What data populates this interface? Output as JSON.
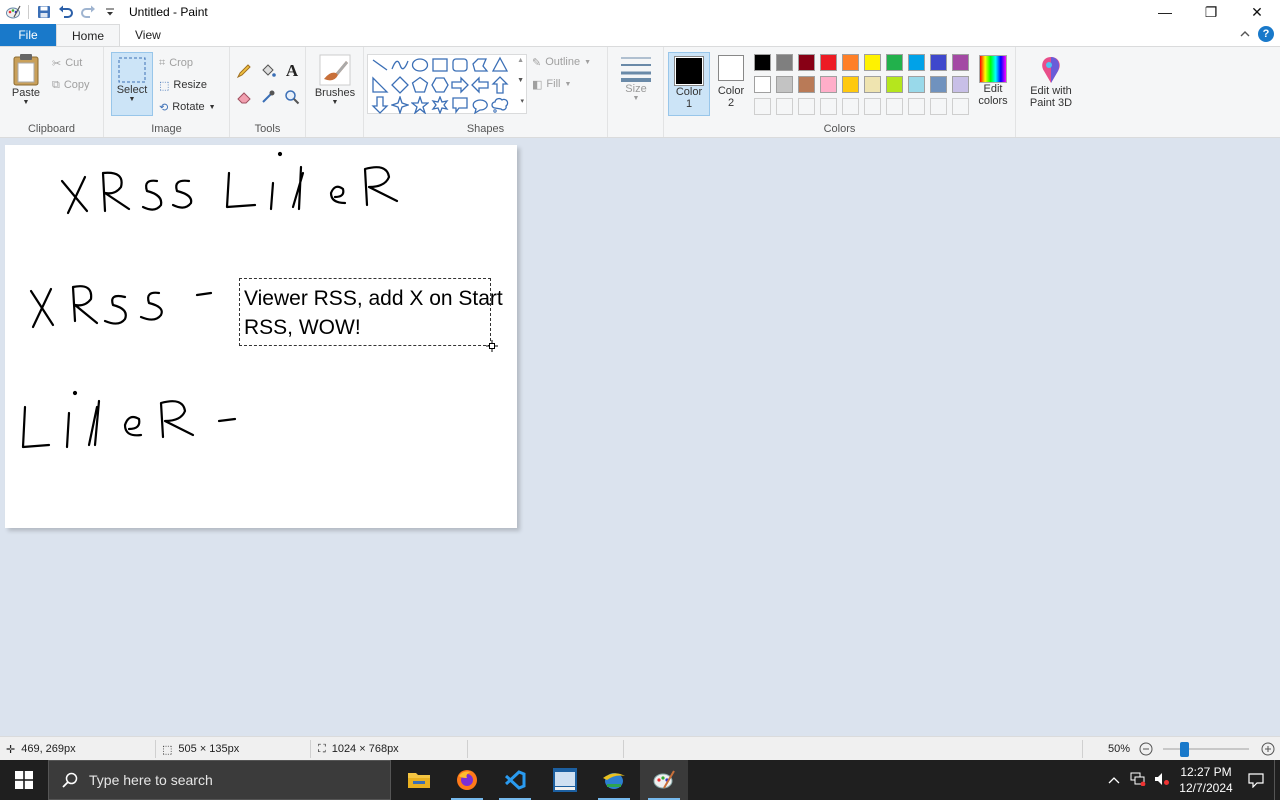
{
  "window": {
    "title": "Untitled - Paint",
    "minimize": "—",
    "maximize": "❐",
    "close": "✕"
  },
  "tabs": [
    {
      "label": "File"
    },
    {
      "label": "Home"
    },
    {
      "label": "View"
    }
  ],
  "ribbon": {
    "clipboard": {
      "label": "Clipboard",
      "paste": "Paste",
      "cut": "Cut",
      "copy": "Copy"
    },
    "image": {
      "label": "Image",
      "select": "Select",
      "crop": "Crop",
      "resize": "Resize",
      "rotate": "Rotate"
    },
    "tools": {
      "label": "Tools"
    },
    "brushes": {
      "label": "Brushes"
    },
    "shapes": {
      "label": "Shapes",
      "outline": "Outline",
      "fill": "Fill"
    },
    "size": {
      "label": "Size"
    },
    "colors": {
      "label": "Colors",
      "color1": "Color",
      "color1_num": "1",
      "color2": "Color",
      "color2_num": "2",
      "edit_colors_line1": "Edit",
      "edit_colors_line2": "colors",
      "palette_row1": [
        "#000000",
        "#7f7f7f",
        "#880015",
        "#ed1c24",
        "#ff7f27",
        "#fff200",
        "#22b14c",
        "#00a2e8",
        "#3f48cc",
        "#a349a4"
      ],
      "palette_row2": [
        "#ffffff",
        "#c3c3c3",
        "#b97a57",
        "#ffaec9",
        "#ffc90e",
        "#efe4b0",
        "#b5e61d",
        "#99d9ea",
        "#7092be",
        "#c8bfe7"
      ]
    },
    "paint3d": {
      "line1": "Edit with",
      "line2": "Paint 3D"
    }
  },
  "canvas": {
    "text": "Viewer RSS, add X on Start RSS, WOW!",
    "text_line1": "Viewer RSS, add X on Start",
    "text_line2": "RSS, WOW!",
    "handwriting": [
      "XRSS LINER",
      "XRSS -",
      "LINER -"
    ]
  },
  "statusbar": {
    "cursor_pos": "469, 269px",
    "selection_size": "505 × 135px",
    "image_size": "1024 × 768px",
    "zoom": "50%"
  },
  "taskbar": {
    "search_placeholder": "Type here to search",
    "time": "12:27 PM",
    "date": "12/7/2024",
    "apps": [
      "file-explorer",
      "firefox",
      "visual-studio-code",
      "calculator",
      "internet-app",
      "paint"
    ]
  }
}
